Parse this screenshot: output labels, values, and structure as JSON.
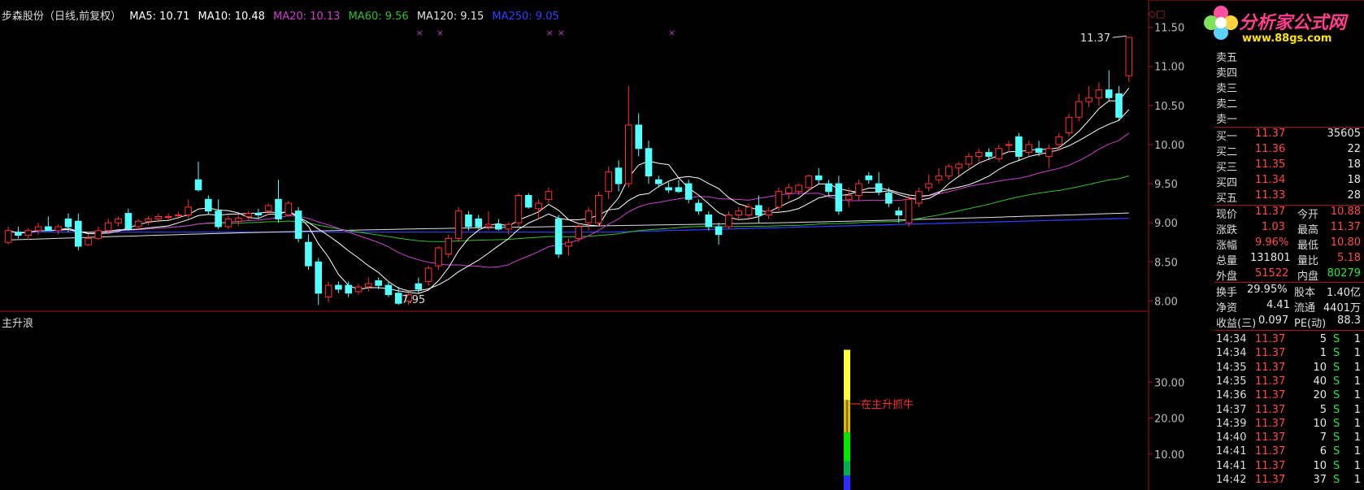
{
  "header": {
    "stock_name": "步森股份（日线,前复权）",
    "ma_items": [
      {
        "label": "MA5: 10.71",
        "color": "#ffffff"
      },
      {
        "label": "MA10: 10.48",
        "color": "#ffffff"
      },
      {
        "label": "MA20: 10.13",
        "color": "#d040d0"
      },
      {
        "label": "MA60: 9.56",
        "color": "#30c030"
      },
      {
        "label": "MA120: 9.15",
        "color": "#e0e0e0"
      },
      {
        "label": "MA250: 9.05",
        "color": "#3040ff"
      }
    ]
  },
  "logo": {
    "title": "分析家公式网",
    "url": "www.88gs.com"
  },
  "price_axis_labels": [
    "11.50",
    "11.00",
    "10.50",
    "10.00",
    "9.50",
    "9.00",
    "8.50",
    "8.00"
  ],
  "indicator_axis_labels": [
    "30.00",
    "20.00",
    "10.00"
  ],
  "indicator_title": "主升浪",
  "indicator_annotation": "一在主升抓牛",
  "chart_annotations": {
    "high_label": "11.37",
    "low_label": "7.95"
  },
  "order_book": {
    "sell": [
      "卖五",
      "卖四",
      "卖三",
      "卖二",
      "卖一"
    ],
    "buy": [
      {
        "label": "买一",
        "price": "11.37",
        "vol": "35605"
      },
      {
        "label": "买二",
        "price": "11.36",
        "vol": "22"
      },
      {
        "label": "买三",
        "price": "11.35",
        "vol": "18"
      },
      {
        "label": "买四",
        "price": "11.34",
        "vol": "18"
      },
      {
        "label": "买五",
        "price": "11.33",
        "vol": "28"
      }
    ]
  },
  "quote": {
    "xianjia_label": "现价",
    "xianjia": "11.37",
    "jinkai_label": "今开",
    "jinkai": "10.88",
    "zhangdie_label": "涨跌",
    "zhangdie": "1.03",
    "zuigao_label": "最高",
    "zuigao": "11.37",
    "zhangfu_label": "涨幅",
    "zhangfu": "9.96%",
    "zuidi_label": "最低",
    "zuidi": "10.80",
    "zongliang_label": "总量",
    "zongliang": "131801",
    "liangbi_label": "量比",
    "liangbi": "5.18",
    "waipan_label": "外盘",
    "waipan": "51522",
    "neipan_label": "内盘",
    "neipan": "80279",
    "huanshou_label": "换手",
    "huanshou": "29.95%",
    "guben_label": "股本",
    "guben": "1.40亿",
    "jingzi_label": "净资",
    "jingzi": "4.41",
    "liutong_label": "流通",
    "liutong": "4401万",
    "shouyi_label": "收益(三)",
    "shouyi": "0.097",
    "pe_label": "PE(动)",
    "pe": "88.3"
  },
  "trades": [
    {
      "time": "14:34",
      "price": "11.37",
      "vol": "5",
      "side": "S",
      "num": "1"
    },
    {
      "time": "14:34",
      "price": "11.37",
      "vol": "1",
      "side": "S",
      "num": "1"
    },
    {
      "time": "14:35",
      "price": "11.37",
      "vol": "10",
      "side": "S",
      "num": "1"
    },
    {
      "time": "14:35",
      "price": "11.37",
      "vol": "40",
      "side": "S",
      "num": "1"
    },
    {
      "time": "14:36",
      "price": "11.37",
      "vol": "20",
      "side": "S",
      "num": "1"
    },
    {
      "time": "14:37",
      "price": "11.37",
      "vol": "5",
      "side": "S",
      "num": "1"
    },
    {
      "time": "14:39",
      "price": "11.37",
      "vol": "10",
      "side": "S",
      "num": "1"
    },
    {
      "time": "14:40",
      "price": "11.37",
      "vol": "7",
      "side": "S",
      "num": "1"
    },
    {
      "time": "14:41",
      "price": "11.37",
      "vol": "6",
      "side": "S",
      "num": "1"
    },
    {
      "time": "14:41",
      "price": "11.37",
      "vol": "10",
      "side": "S",
      "num": "1"
    },
    {
      "time": "14:42",
      "price": "11.37",
      "vol": "37",
      "side": "S",
      "num": "1"
    }
  ],
  "colors": {
    "up": "#ff3030",
    "down": "#54ffff",
    "axis": "#a01818",
    "ma5": "#ffffff",
    "ma10": "#ffffff",
    "ma20": "#d040d0",
    "ma60": "#30c030",
    "ma120": "#e0e0e0",
    "ma250": "#3040ff"
  },
  "chart_data": {
    "type": "candlestick",
    "ylim": [
      7.9,
      11.6
    ],
    "candles": [
      {
        "o": 8.75,
        "h": 8.95,
        "l": 8.72,
        "c": 8.9
      },
      {
        "o": 8.88,
        "h": 8.95,
        "l": 8.8,
        "c": 8.84
      },
      {
        "o": 8.84,
        "h": 8.93,
        "l": 8.78,
        "c": 8.9
      },
      {
        "o": 8.9,
        "h": 9.0,
        "l": 8.85,
        "c": 8.95
      },
      {
        "o": 8.95,
        "h": 9.08,
        "l": 8.9,
        "c": 8.9
      },
      {
        "o": 8.9,
        "h": 8.98,
        "l": 8.85,
        "c": 8.95
      },
      {
        "o": 9.05,
        "h": 9.12,
        "l": 8.88,
        "c": 8.95
      },
      {
        "o": 9.02,
        "h": 9.12,
        "l": 8.65,
        "c": 8.7
      },
      {
        "o": 8.72,
        "h": 8.85,
        "l": 8.7,
        "c": 8.8
      },
      {
        "o": 8.8,
        "h": 8.95,
        "l": 8.78,
        "c": 8.9
      },
      {
        "o": 8.9,
        "h": 9.05,
        "l": 8.85,
        "c": 9.0
      },
      {
        "o": 9.0,
        "h": 9.08,
        "l": 8.95,
        "c": 9.05
      },
      {
        "o": 9.12,
        "h": 9.18,
        "l": 8.9,
        "c": 8.92
      },
      {
        "o": 8.95,
        "h": 9.05,
        "l": 8.9,
        "c": 9.02
      },
      {
        "o": 9.02,
        "h": 9.08,
        "l": 8.97,
        "c": 9.05
      },
      {
        "o": 9.05,
        "h": 9.12,
        "l": 9.0,
        "c": 9.08
      },
      {
        "o": 9.08,
        "h": 9.12,
        "l": 9.04,
        "c": 9.08
      },
      {
        "o": 9.1,
        "h": 9.14,
        "l": 9.05,
        "c": 9.1
      },
      {
        "o": 9.1,
        "h": 9.3,
        "l": 9.05,
        "c": 9.2
      },
      {
        "o": 9.55,
        "h": 9.78,
        "l": 9.4,
        "c": 9.42
      },
      {
        "o": 9.3,
        "h": 9.35,
        "l": 9.1,
        "c": 9.15
      },
      {
        "o": 9.15,
        "h": 9.3,
        "l": 8.92,
        "c": 8.95
      },
      {
        "o": 8.95,
        "h": 9.1,
        "l": 8.92,
        "c": 9.05
      },
      {
        "o": 9.02,
        "h": 9.1,
        "l": 8.96,
        "c": 9.06
      },
      {
        "o": 9.08,
        "h": 9.15,
        "l": 9.03,
        "c": 9.12
      },
      {
        "o": 9.12,
        "h": 9.18,
        "l": 9.05,
        "c": 9.1
      },
      {
        "o": 9.15,
        "h": 9.25,
        "l": 9.1,
        "c": 9.22
      },
      {
        "o": 9.3,
        "h": 9.55,
        "l": 9.0,
        "c": 9.05
      },
      {
        "o": 9.1,
        "h": 9.28,
        "l": 9.08,
        "c": 9.25
      },
      {
        "o": 9.15,
        "h": 9.2,
        "l": 8.75,
        "c": 8.8
      },
      {
        "o": 8.75,
        "h": 8.85,
        "l": 8.4,
        "c": 8.45
      },
      {
        "o": 8.5,
        "h": 8.55,
        "l": 7.95,
        "c": 8.1
      },
      {
        "o": 8.05,
        "h": 8.25,
        "l": 7.98,
        "c": 8.2
      },
      {
        "o": 8.2,
        "h": 8.25,
        "l": 8.1,
        "c": 8.15
      },
      {
        "o": 8.2,
        "h": 8.25,
        "l": 8.05,
        "c": 8.1
      },
      {
        "o": 8.12,
        "h": 8.22,
        "l": 8.08,
        "c": 8.18
      },
      {
        "o": 8.18,
        "h": 8.3,
        "l": 8.12,
        "c": 8.22
      },
      {
        "o": 8.26,
        "h": 8.3,
        "l": 8.15,
        "c": 8.2
      },
      {
        "o": 8.2,
        "h": 8.25,
        "l": 8.05,
        "c": 8.08
      },
      {
        "o": 8.1,
        "h": 8.18,
        "l": 7.95,
        "c": 7.97
      },
      {
        "o": 8.0,
        "h": 8.1,
        "l": 7.95,
        "c": 8.08
      },
      {
        "o": 8.22,
        "h": 8.3,
        "l": 8.1,
        "c": 8.15
      },
      {
        "o": 8.25,
        "h": 8.45,
        "l": 8.2,
        "c": 8.42
      },
      {
        "o": 8.45,
        "h": 8.7,
        "l": 8.4,
        "c": 8.68
      },
      {
        "o": 8.6,
        "h": 8.85,
        "l": 8.55,
        "c": 8.8
      },
      {
        "o": 8.8,
        "h": 9.2,
        "l": 8.75,
        "c": 9.15
      },
      {
        "o": 9.1,
        "h": 9.15,
        "l": 8.9,
        "c": 8.95
      },
      {
        "o": 9.05,
        "h": 9.1,
        "l": 8.92,
        "c": 8.95
      },
      {
        "o": 8.95,
        "h": 9.15,
        "l": 8.9,
        "c": 8.98
      },
      {
        "o": 8.98,
        "h": 9.05,
        "l": 8.9,
        "c": 8.92
      },
      {
        "o": 8.92,
        "h": 9.0,
        "l": 8.85,
        "c": 8.98
      },
      {
        "o": 9.0,
        "h": 9.38,
        "l": 8.95,
        "c": 9.35
      },
      {
        "o": 9.35,
        "h": 9.38,
        "l": 9.18,
        "c": 9.2
      },
      {
        "o": 9.18,
        "h": 9.3,
        "l": 9.05,
        "c": 9.25
      },
      {
        "o": 9.3,
        "h": 9.45,
        "l": 9.25,
        "c": 9.4
      },
      {
        "o": 9.05,
        "h": 9.1,
        "l": 8.55,
        "c": 8.6
      },
      {
        "o": 8.7,
        "h": 8.8,
        "l": 8.58,
        "c": 8.75
      },
      {
        "o": 8.8,
        "h": 9.0,
        "l": 8.75,
        "c": 8.95
      },
      {
        "o": 9.0,
        "h": 9.2,
        "l": 8.9,
        "c": 9.15
      },
      {
        "o": 9.0,
        "h": 9.4,
        "l": 8.95,
        "c": 9.35
      },
      {
        "o": 9.4,
        "h": 9.72,
        "l": 9.3,
        "c": 9.65
      },
      {
        "o": 9.7,
        "h": 9.8,
        "l": 9.4,
        "c": 9.5
      },
      {
        "o": 9.5,
        "h": 10.75,
        "l": 9.45,
        "c": 10.25
      },
      {
        "o": 10.25,
        "h": 10.4,
        "l": 9.85,
        "c": 9.95
      },
      {
        "o": 9.95,
        "h": 10.05,
        "l": 9.5,
        "c": 9.6
      },
      {
        "o": 9.55,
        "h": 9.6,
        "l": 9.45,
        "c": 9.5
      },
      {
        "o": 9.45,
        "h": 9.52,
        "l": 9.38,
        "c": 9.42
      },
      {
        "o": 9.45,
        "h": 9.55,
        "l": 9.38,
        "c": 9.4
      },
      {
        "o": 9.5,
        "h": 9.55,
        "l": 9.25,
        "c": 9.3
      },
      {
        "o": 9.25,
        "h": 9.3,
        "l": 9.1,
        "c": 9.15
      },
      {
        "o": 9.1,
        "h": 9.15,
        "l": 8.9,
        "c": 8.95
      },
      {
        "o": 8.95,
        "h": 9.0,
        "l": 8.72,
        "c": 8.85
      },
      {
        "o": 8.95,
        "h": 9.15,
        "l": 8.92,
        "c": 9.1
      },
      {
        "o": 9.1,
        "h": 9.2,
        "l": 9.05,
        "c": 9.15
      },
      {
        "o": 9.1,
        "h": 9.25,
        "l": 9.05,
        "c": 9.2
      },
      {
        "o": 9.22,
        "h": 9.35,
        "l": 9.0,
        "c": 9.1
      },
      {
        "o": 9.1,
        "h": 9.2,
        "l": 9.05,
        "c": 9.15
      },
      {
        "o": 9.2,
        "h": 9.45,
        "l": 9.15,
        "c": 9.4
      },
      {
        "o": 9.38,
        "h": 9.5,
        "l": 9.3,
        "c": 9.45
      },
      {
        "o": 9.4,
        "h": 9.5,
        "l": 9.35,
        "c": 9.48
      },
      {
        "o": 9.45,
        "h": 9.62,
        "l": 9.4,
        "c": 9.6
      },
      {
        "o": 9.6,
        "h": 9.7,
        "l": 9.5,
        "c": 9.55
      },
      {
        "o": 9.5,
        "h": 9.55,
        "l": 9.35,
        "c": 9.4
      },
      {
        "o": 9.5,
        "h": 9.6,
        "l": 9.1,
        "c": 9.15
      },
      {
        "o": 9.3,
        "h": 9.45,
        "l": 9.2,
        "c": 9.35
      },
      {
        "o": 9.35,
        "h": 9.55,
        "l": 9.28,
        "c": 9.5
      },
      {
        "o": 9.6,
        "h": 9.65,
        "l": 9.5,
        "c": 9.55
      },
      {
        "o": 9.5,
        "h": 9.65,
        "l": 9.35,
        "c": 9.4
      },
      {
        "o": 9.38,
        "h": 9.45,
        "l": 9.2,
        "c": 9.25
      },
      {
        "o": 9.15,
        "h": 9.2,
        "l": 9.0,
        "c": 9.1
      },
      {
        "o": 9.0,
        "h": 9.35,
        "l": 8.95,
        "c": 9.3
      },
      {
        "o": 9.25,
        "h": 9.45,
        "l": 9.2,
        "c": 9.4
      },
      {
        "o": 9.45,
        "h": 9.62,
        "l": 9.4,
        "c": 9.5
      },
      {
        "o": 9.55,
        "h": 9.7,
        "l": 9.5,
        "c": 9.6
      },
      {
        "o": 9.6,
        "h": 9.75,
        "l": 9.55,
        "c": 9.72
      },
      {
        "o": 9.7,
        "h": 9.78,
        "l": 9.6,
        "c": 9.75
      },
      {
        "o": 9.75,
        "h": 9.9,
        "l": 9.7,
        "c": 9.85
      },
      {
        "o": 9.85,
        "h": 9.95,
        "l": 9.78,
        "c": 9.9
      },
      {
        "o": 9.9,
        "h": 9.95,
        "l": 9.8,
        "c": 9.85
      },
      {
        "o": 9.82,
        "h": 10.0,
        "l": 9.78,
        "c": 9.95
      },
      {
        "o": 10.0,
        "h": 10.05,
        "l": 9.9,
        "c": 10.0
      },
      {
        "o": 10.1,
        "h": 10.15,
        "l": 9.8,
        "c": 9.85
      },
      {
        "o": 9.9,
        "h": 10.05,
        "l": 9.85,
        "c": 10.0
      },
      {
        "o": 9.95,
        "h": 10.05,
        "l": 9.85,
        "c": 9.9
      },
      {
        "o": 9.85,
        "h": 10.0,
        "l": 9.7,
        "c": 9.95
      },
      {
        "o": 10.0,
        "h": 10.15,
        "l": 9.92,
        "c": 10.1
      },
      {
        "o": 10.15,
        "h": 10.4,
        "l": 10.1,
        "c": 10.35
      },
      {
        "o": 10.35,
        "h": 10.65,
        "l": 10.3,
        "c": 10.55
      },
      {
        "o": 10.55,
        "h": 10.75,
        "l": 10.48,
        "c": 10.6
      },
      {
        "o": 10.6,
        "h": 10.8,
        "l": 10.5,
        "c": 10.7
      },
      {
        "o": 10.7,
        "h": 10.95,
        "l": 10.55,
        "c": 10.6
      },
      {
        "o": 10.65,
        "h": 10.75,
        "l": 10.3,
        "c": 10.35
      },
      {
        "o": 10.88,
        "h": 11.37,
        "l": 10.8,
        "c": 11.37
      }
    ],
    "indicator": {
      "ylim": [
        0,
        40
      ],
      "bar_top": 39,
      "segments": [
        {
          "from": 0,
          "to": 4,
          "color": "#2d2dff"
        },
        {
          "from": 4,
          "to": 8,
          "color": "#00b050"
        },
        {
          "from": 8,
          "to": 16,
          "color": "#00e800"
        },
        {
          "from": 16,
          "to": 25,
          "color": "#c8c800"
        },
        {
          "from": 25,
          "to": 39,
          "color": "#ffff40"
        }
      ]
    }
  }
}
